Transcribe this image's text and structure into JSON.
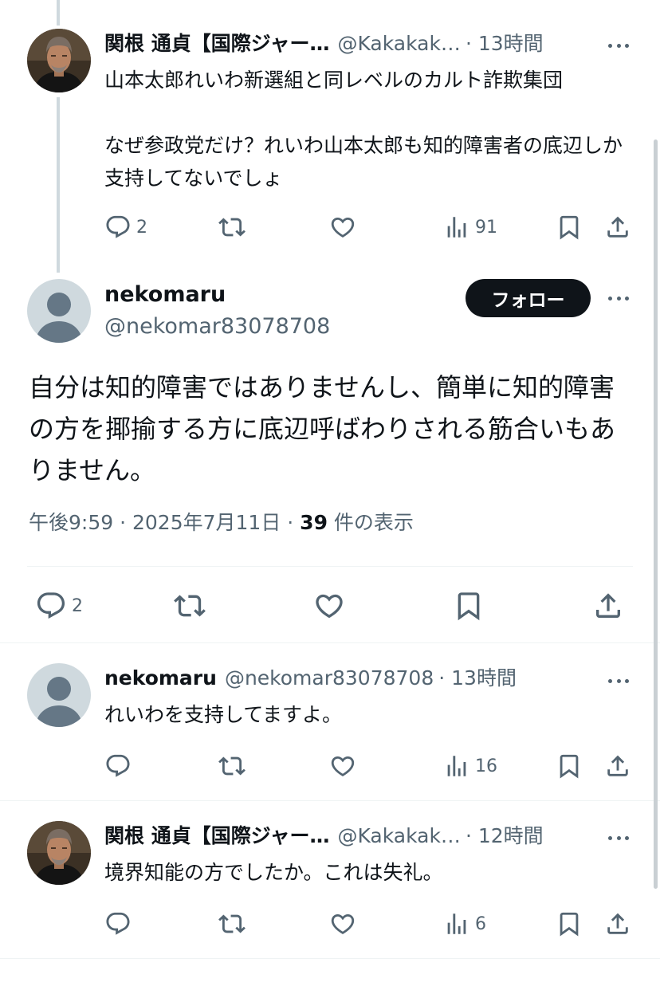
{
  "parent_reply": {
    "name": "関根 通貞【国際ジャー…",
    "handle": "@Kakakak…",
    "time": "· 13時間",
    "text": "山本太郎れいわ新選組と同レベルのカルト詐欺集団\n\nなぜ参政党だけ？れいわ山本太郎も知的障害者の底辺しか支持してないでしょ",
    "reply_count": "2",
    "views": "91",
    "avatar_icon": "man-portrait-avatar"
  },
  "main_post": {
    "name": "nekomaru",
    "handle": "@nekomar83078708",
    "follow_label": "フォロー",
    "text": "自分は知的障害ではありませんし、簡単に知的障害の方を揶揄する方に底辺呼ばわりされる筋合いもありません。",
    "time": "午後9:59",
    "sep1": " · ",
    "date": "2025年7月11日",
    "sep2": " · ",
    "views_count": "39",
    "views_label": " 件の表示",
    "reply_count": "2",
    "avatar_icon": "default-user-avatar"
  },
  "replies": [
    {
      "name": "nekomaru",
      "handle": "@nekomar83078708",
      "time": "· 13時間",
      "text": "れいわを支持してますよ。",
      "views": "16",
      "avatar_icon": "default-user-avatar"
    },
    {
      "name": "関根 通貞【国際ジャー…",
      "handle": "@Kakakak…",
      "time": "· 12時間",
      "text": "境界知能の方でしたか。これは失礼。",
      "views": "6",
      "avatar_icon": "man-portrait-avatar"
    }
  ],
  "colors": {
    "text": "#0f1419",
    "secondary": "#536471",
    "divider": "#eff3f4",
    "thread_line": "#cfd9de",
    "follow_bg": "#0f1419"
  }
}
